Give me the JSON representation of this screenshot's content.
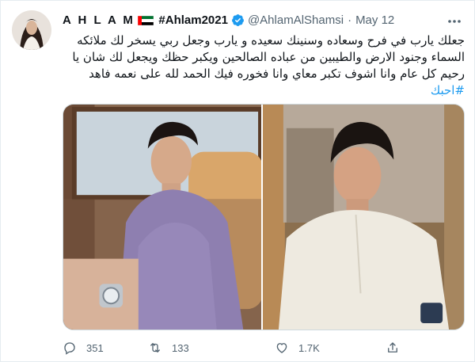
{
  "author": {
    "display_name": "A H L A M",
    "hashtag_name": "#Ahlam2021",
    "handle": "@AhlamAlShamsi",
    "separator": "·",
    "date": "May 12"
  },
  "tweet": {
    "lines": [
      "جعلك يارب في فرح وسعاده وسنينك سعيده و يارب وجعل ربي يسخر لك ملائكه",
      "السماء وجنود الارض والطيبين من عباده الصالحين ويكبر حظك ويجعل لك شان يا",
      "رحيم كل عام وانا اشوف تكبر معاي وانا فخوره فيك الحمد لله على نعمه فاهد"
    ],
    "hashtag": "#احبك"
  },
  "actions": {
    "reply_count": "351",
    "retweet_count": "133",
    "like_count": "1.7K"
  },
  "icons": {
    "verified": "verified-badge-icon",
    "flag": "uae-flag-icon",
    "more": "more-dots-icon",
    "reply": "reply-icon",
    "retweet": "retweet-icon",
    "like": "heart-icon",
    "share": "share-icon"
  },
  "colors": {
    "link": "#1d9bf0",
    "muted": "#536471",
    "text": "#0f1419",
    "border": "#cfd9de"
  }
}
